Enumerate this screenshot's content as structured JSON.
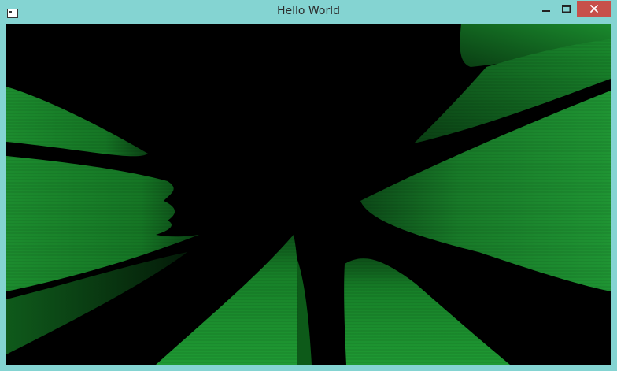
{
  "window": {
    "title": "Hello World"
  },
  "titlebar_buttons": {
    "minimize": "minimize-icon",
    "maximize": "maximize-icon",
    "close": "close-icon"
  },
  "colors": {
    "frame": "#84d4d2",
    "close_button": "#c7504a",
    "scene_background": "#000000",
    "leaf_green": "#1f9a33",
    "leaf_dark": "#0a3a12"
  }
}
